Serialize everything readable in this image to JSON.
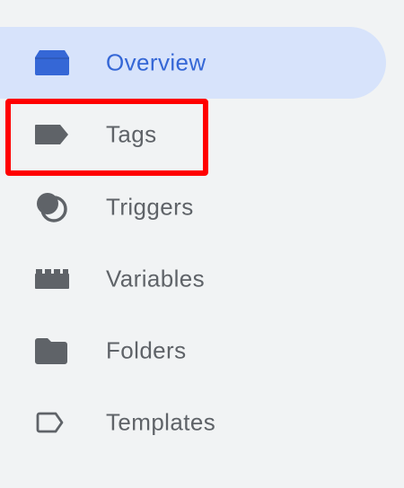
{
  "colors": {
    "background": "#f1f3f4",
    "active_background": "#d7e3fb",
    "active_text": "#3567d6",
    "text": "#5f6368",
    "icon": "#5f6368",
    "highlight": "#ff0000"
  },
  "nav": {
    "items": [
      {
        "label": "Overview",
        "icon": "overview-icon",
        "active": true
      },
      {
        "label": "Tags",
        "icon": "tag-icon",
        "active": false
      },
      {
        "label": "Triggers",
        "icon": "triggers-icon",
        "active": false
      },
      {
        "label": "Variables",
        "icon": "variables-icon",
        "active": false
      },
      {
        "label": "Folders",
        "icon": "folder-icon",
        "active": false
      },
      {
        "label": "Templates",
        "icon": "template-icon",
        "active": false
      }
    ]
  }
}
